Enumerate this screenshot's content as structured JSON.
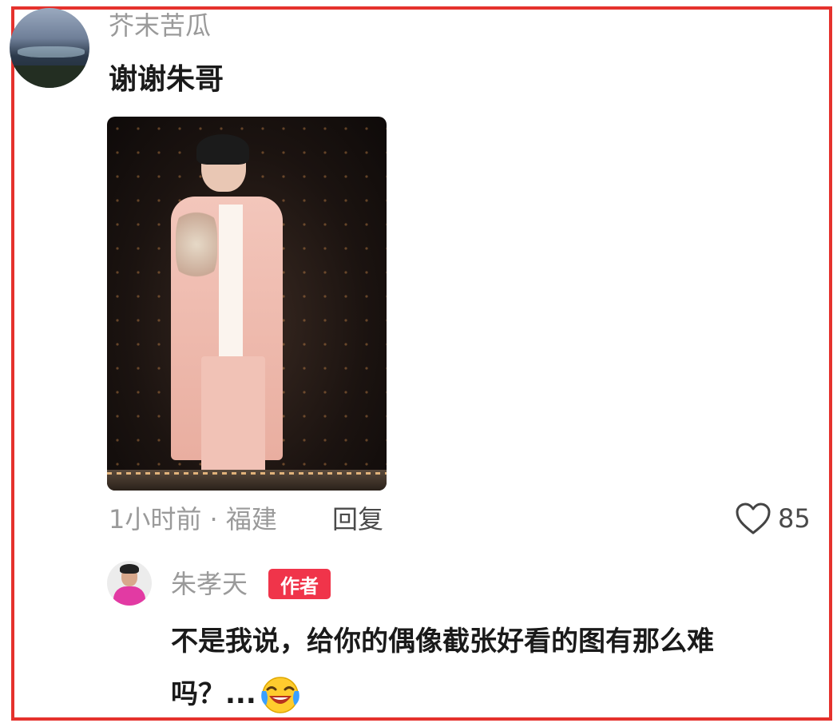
{
  "comment": {
    "username": "芥末苦瓜",
    "text": "谢谢朱哥",
    "avatar_icon": "landscape-avatar",
    "image_icon": "performer-in-pink-suit-photo",
    "time_location": "1小时前 · 福建",
    "reply_label": "回复",
    "likes": "85",
    "like_icon": "heart-outline-icon"
  },
  "reply": {
    "username": "朱孝天",
    "badge": "作者",
    "avatar_icon": "man-in-pink-avatar",
    "text_line1": "不是我说，给你的偶像截张好看的图有那么难",
    "text_line2": "吗？...",
    "emoji_icon": "laughing-crying-emoji"
  },
  "colors": {
    "frame": "#e5322d",
    "badge_bg": "#f0344a",
    "muted_text": "#9a9a9a"
  }
}
